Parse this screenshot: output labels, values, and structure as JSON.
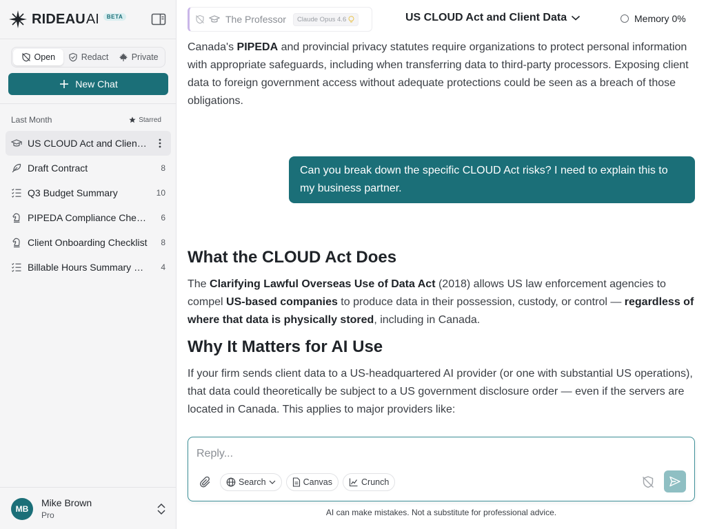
{
  "brand": {
    "name": "RIDEAU",
    "suffix": "AI",
    "badge": "BETA"
  },
  "modes": [
    {
      "label": "Open",
      "icon": "shield-off-icon",
      "active": true
    },
    {
      "label": "Redact",
      "icon": "shield-check-icon",
      "active": false
    },
    {
      "label": "Private",
      "icon": "maple-leaf-icon",
      "active": false
    }
  ],
  "new_chat_label": "New Chat",
  "sidebar": {
    "section_label": "Last Month",
    "starred_label": "Starred",
    "items": [
      {
        "title": "US CLOUD Act and Client Data",
        "count": "",
        "icon": "graduation-cap-icon",
        "active": true
      },
      {
        "title": "Draft Contract",
        "count": "8",
        "icon": "feather-icon",
        "active": false
      },
      {
        "title": "Q3 Budget Summary",
        "count": "10",
        "icon": "checklist-icon",
        "active": false
      },
      {
        "title": "PIPEDA Compliance Checklist",
        "count": "6",
        "icon": "chess-knight-icon",
        "active": false
      },
      {
        "title": "Client Onboarding Checklist",
        "count": "8",
        "icon": "chess-knight-icon",
        "active": false
      },
      {
        "title": "Billable Hours Summary Report",
        "count": "4",
        "icon": "checklist-icon",
        "active": false
      }
    ]
  },
  "user": {
    "initials": "MB",
    "name": "Mike Brown",
    "plan": "Pro"
  },
  "header": {
    "persona": "The Professor",
    "model": "Claude Opus 4.6",
    "title": "US CLOUD Act and Client Data",
    "memory": "Memory 0%"
  },
  "messages": {
    "intro_pre": "Canada's ",
    "intro_bold": "PIPEDA",
    "intro_post": " and provincial privacy statutes require organizations to protect personal information with appropriate safeguards, including when transferring data to third-party processors. Exposing client data to foreign government access without adequate protections could be seen as a breach of those obligations.",
    "user_message": "Can you break down the specific CLOUD Act risks? I need to explain this to my business partner.",
    "h1": "What the CLOUD Act Does",
    "p1_a": "The ",
    "p1_b": "Clarifying Lawful Overseas Use of Data Act",
    "p1_c": " (2018) allows US law enforcement agencies to compel ",
    "p1_d": "US-based companies",
    "p1_e": " to produce data in their possession, custody, or control — ",
    "p1_f": "regardless of where that data is physically stored",
    "p1_g": ", including in Canada.",
    "h2": "Why It Matters for AI Use",
    "p2": "If your firm sends client data to a US-headquartered AI provider (or one with substantial US operations), that data could theoretically be subject to a US government disclosure order — even if the servers are located in Canada. This applies to major providers like:"
  },
  "composer": {
    "placeholder": "Reply...",
    "search_label": "Search",
    "canvas_label": "Canvas",
    "crunch_label": "Crunch"
  },
  "disclaimer": "AI can make mistakes. Not a substitute for professional advice.",
  "colors": {
    "accent": "#1b6f78",
    "send_disabled": "#8fbfc3",
    "persona_bar": "#c9b6e8"
  }
}
